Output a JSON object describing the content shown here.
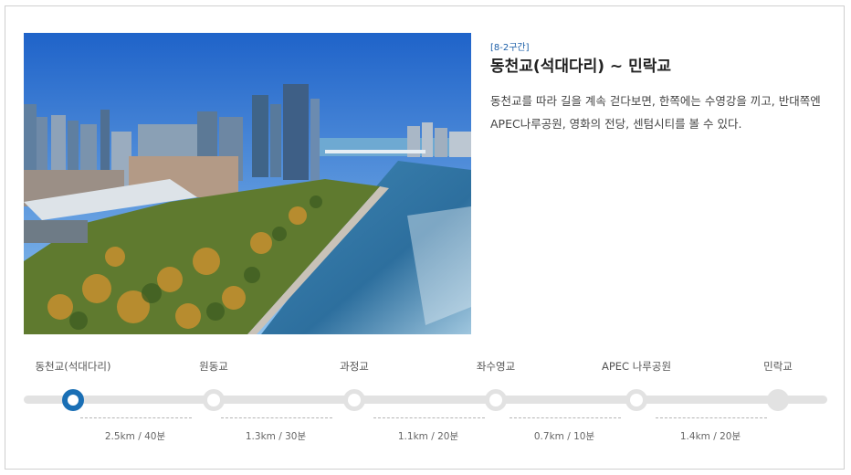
{
  "section": {
    "badge": "[8-2구간]",
    "title": "동천교(석대다리) ~ 민락교",
    "description": "동천교를 따라 길을 계속 걷다보면, 한쪽에는 수영강을 끼고, 반대쪽엔 APEC나루공원, 영화의 전당, 센텀시티를 볼 수 있다."
  },
  "route": {
    "stops": [
      {
        "label": "동천교(석대다리)",
        "state": "active"
      },
      {
        "label": "원동교",
        "state": "normal"
      },
      {
        "label": "과정교",
        "state": "normal"
      },
      {
        "label": "좌수영교",
        "state": "normal"
      },
      {
        "label": "APEC 나루공원",
        "state": "normal"
      },
      {
        "label": "민락교",
        "state": "end"
      }
    ],
    "segments": [
      {
        "label": "2.5km / 40분"
      },
      {
        "label": "1.3km / 30분"
      },
      {
        "label": "1.1km / 20분"
      },
      {
        "label": "0.7km / 10분"
      },
      {
        "label": "1.4km / 20분"
      }
    ]
  },
  "colors": {
    "accent": "#1a6fb5",
    "track": "#e2e2e2"
  }
}
